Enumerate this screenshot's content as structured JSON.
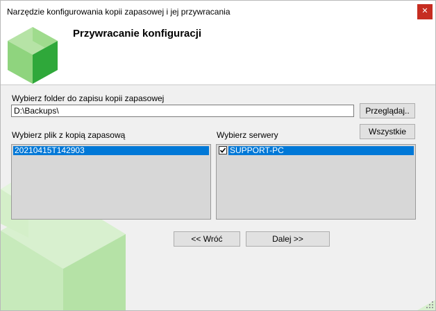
{
  "window": {
    "title": "Narzędzie konfigurowania kopii zapasowej i jej przywracania"
  },
  "header": {
    "title": "Przywracanie konfiguracji"
  },
  "folder": {
    "label": "Wybierz folder do zapisu kopii zapasowej",
    "value": "D:\\Backups\\",
    "browse_label": "Przeglądaj.."
  },
  "backup_files": {
    "label": "Wybierz plik z kopią zapasową",
    "items": [
      "20210415T142903"
    ]
  },
  "servers": {
    "label": "Wybierz serwery",
    "all_label": "Wszystkie",
    "items": [
      {
        "name": "SUPPORT-PC",
        "checked": true
      }
    ]
  },
  "nav": {
    "back_label": "<< Wróć",
    "next_label": "Dalej >>"
  },
  "colors": {
    "accent": "#0078d7",
    "close": "#c62d21",
    "logo_green": "#3ab44a"
  }
}
